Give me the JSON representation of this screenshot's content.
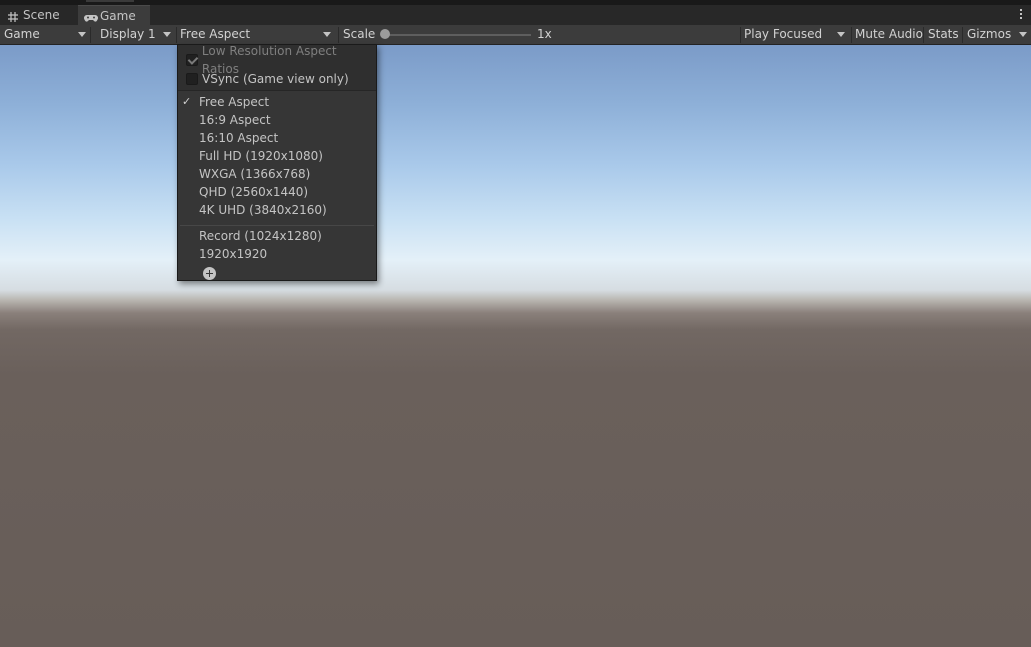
{
  "tabs": [
    {
      "label": "Scene",
      "icon": "grid-icon"
    },
    {
      "label": "Game",
      "icon": "gamepad-icon",
      "active": true
    }
  ],
  "toolbar": {
    "view_mode": "Game",
    "display": "Display 1",
    "aspect": "Free Aspect",
    "scale_label": "Scale",
    "scale_value": "1x",
    "play_mode": "Play Focused",
    "mute_audio": "Mute Audio",
    "stats": "Stats",
    "gizmos": "Gizmos"
  },
  "dropdown": {
    "low_res_label": "Low Resolution Aspect Ratios",
    "low_res_checked": true,
    "vsync_label": "VSync (Game view only)",
    "vsync_checked": false,
    "items": [
      {
        "label": "Free Aspect",
        "selected": true
      },
      {
        "label": "16:9 Aspect"
      },
      {
        "label": "16:10 Aspect"
      },
      {
        "label": "Full HD (1920x1080)"
      },
      {
        "label": "WXGA (1366x768)"
      },
      {
        "label": "QHD (2560x1440)"
      },
      {
        "label": "4K UHD (3840x2160)"
      }
    ],
    "custom_items": [
      {
        "label": "Record (1024x1280)"
      },
      {
        "label": "1920x1920"
      }
    ],
    "selected_mark": "✓"
  },
  "colors": {
    "toolbar_bg": "#3c3c3c",
    "menu_bg": "#363636",
    "sky_top": "#7b9bc8",
    "horizon": "#e4f0f8",
    "ground": "#675d58"
  }
}
